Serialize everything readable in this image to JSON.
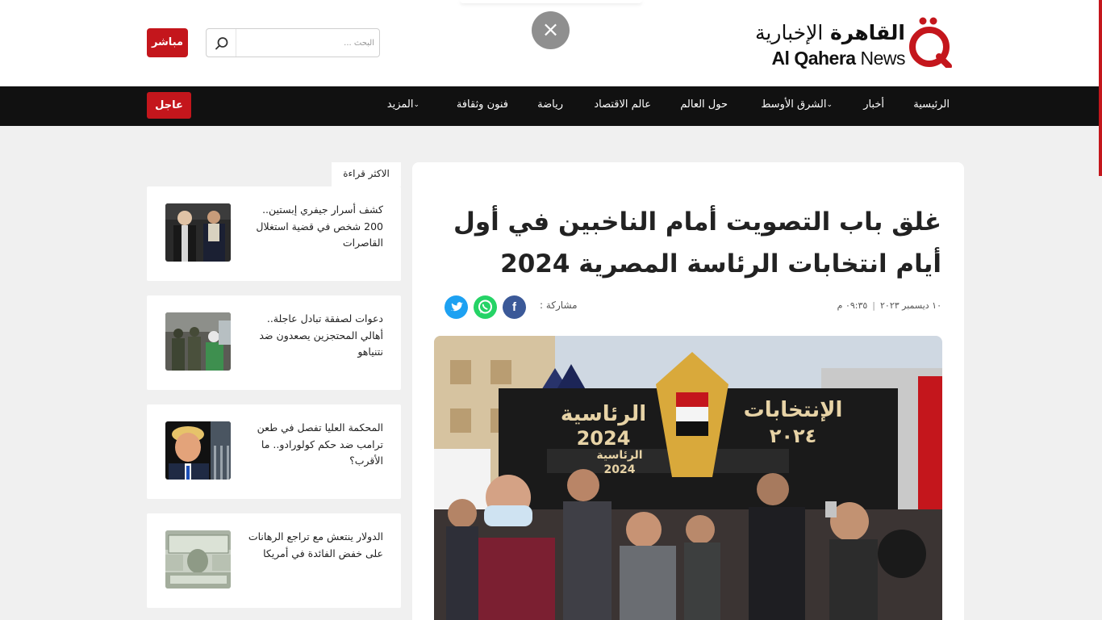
{
  "header": {
    "logo_ar_bold": "القاهرة",
    "logo_ar_light": "الإخبارية",
    "logo_en_bold": "Al Qahera",
    "logo_en_light": "News",
    "close_label": "×",
    "search_placeholder": "البحث ...",
    "live_label": "مباشر"
  },
  "nav": {
    "items": [
      {
        "label": "الرئيسية"
      },
      {
        "label": "أخبار"
      },
      {
        "label": "الشرق الأوسط",
        "has_dropdown": true
      },
      {
        "label": "حول العالم"
      },
      {
        "label": "عالم الاقتصاد"
      },
      {
        "label": "رياضة"
      },
      {
        "label": "فنون وثقافة"
      },
      {
        "label": "المزيد",
        "has_dropdown": true
      }
    ],
    "breaking_label": "عاجل"
  },
  "sidebar": {
    "section_title": "الاكثر قراءة",
    "items": [
      {
        "title": "كشف أسرار جيفري إبستين.. 200 شخص في قضية استغلال القاصرات",
        "thumb_icon": "two-men-photo"
      },
      {
        "title": "دعوات لصفقة تبادل عاجلة.. أهالي المحتجزين يصعدون ضد نتنياهو",
        "thumb_icon": "soldiers-photo"
      },
      {
        "title": "المحكمة العليا تفصل في طعن ترامب ضد حكم كولورادو.. ما الأقرب؟",
        "thumb_icon": "trump-photo"
      },
      {
        "title": "الدولار ينتعش مع تراجع الرهانات على خفض الفائدة في أمريكا",
        "thumb_icon": "dollar-bills-photo"
      }
    ]
  },
  "article": {
    "headline": "غلق باب التصويت أمام الناخبين في أول أيام انتخابات الرئاسة المصرية 2024",
    "date": "١٠ ديسمبر ٢٠٢٣",
    "time": "٠٩:٣٥ م",
    "share_label": "مشاركة :",
    "hero_sign_left": "الرئاسية",
    "hero_sign_left_year": "2024",
    "hero_sign_right": "الإنتخابات",
    "hero_sign_right_year": "٢٠٢٤",
    "hero_sign_center": "الرئاسية",
    "hero_sign_center_year": "2024"
  },
  "colors": {
    "brand_red": "#c4161c",
    "nav_bg": "#111111",
    "facebook": "#3b5998",
    "whatsapp": "#25d366",
    "twitter": "#1da1f2"
  }
}
